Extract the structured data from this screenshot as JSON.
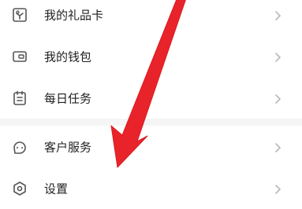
{
  "menu": {
    "group1": [
      {
        "label": "我的礼品卡",
        "icon": "gift-card-icon"
      },
      {
        "label": "我的钱包",
        "icon": "wallet-icon"
      },
      {
        "label": "每日任务",
        "icon": "calendar-task-icon"
      }
    ],
    "group2": [
      {
        "label": "客户服务",
        "icon": "customer-service-icon"
      },
      {
        "label": "设置",
        "icon": "settings-icon"
      }
    ]
  },
  "overlay": {
    "annotation": "red-arrow-pointing-to-customer-service",
    "color": "#e8242a"
  },
  "colors": {
    "icon": "#555555",
    "chevron": "#b8b8b8",
    "separator": "#f5f5f5"
  }
}
